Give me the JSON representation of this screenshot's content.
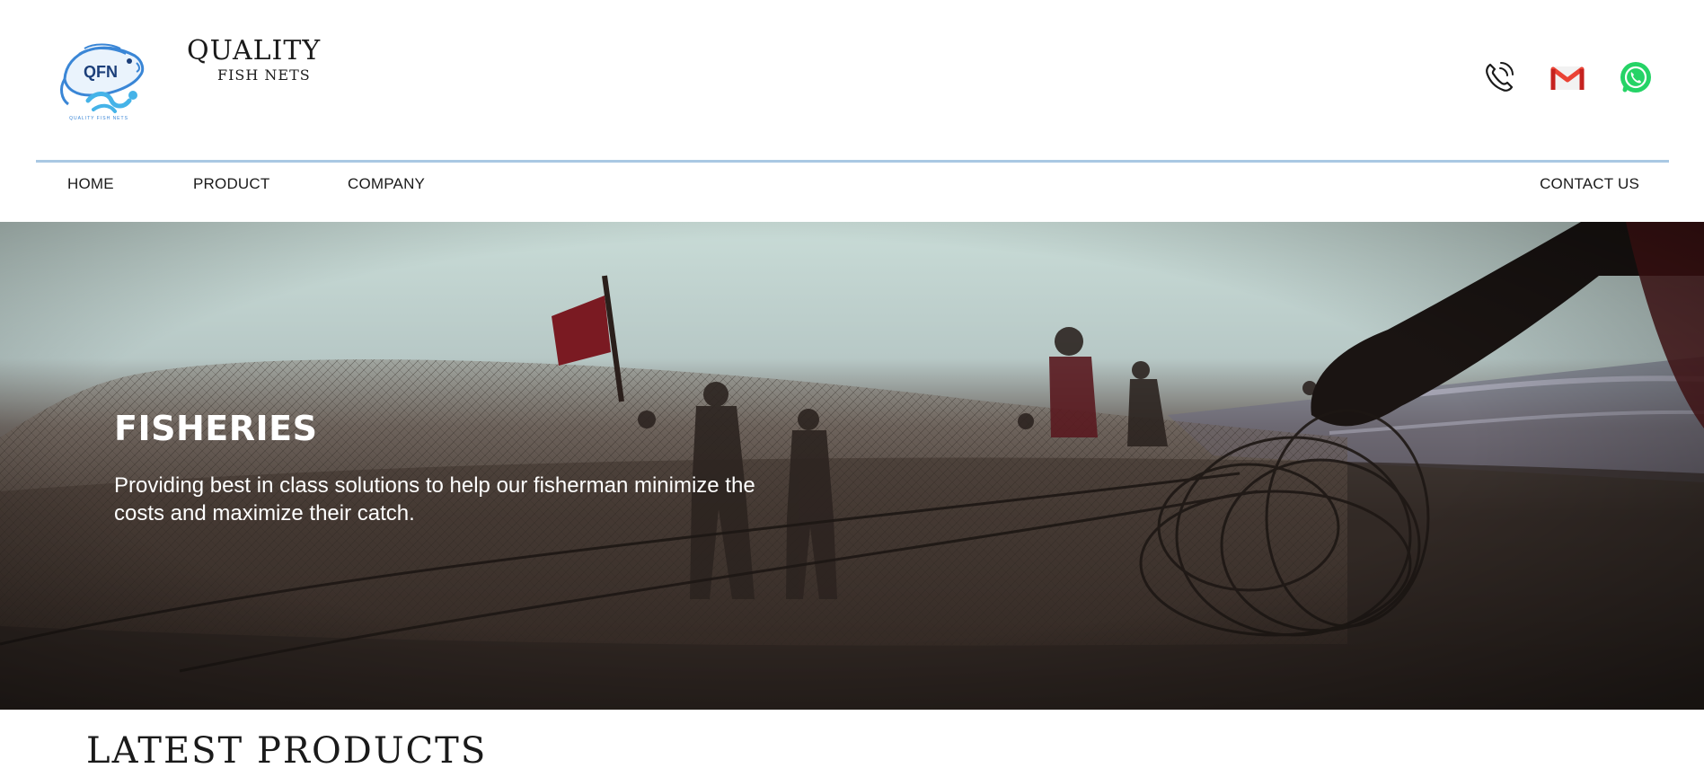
{
  "header": {
    "brand_title": "QUALITY",
    "brand_subtitle": "FISH NETS",
    "logo_text": "QFN",
    "logo_tagline": "QUALITY FISH NETS",
    "icons": [
      "phone-icon",
      "gmail-icon",
      "whatsapp-icon"
    ]
  },
  "nav": {
    "home": "HOME",
    "product": "PRODUCT",
    "company": "COMPANY",
    "contact": "CONTACT US"
  },
  "hero": {
    "title": "FISHERIES",
    "text": "Providing best in class solutions to help our fisherman minimize the costs and maximize their catch."
  },
  "latest": {
    "title": "LATEST PRODUCTS"
  },
  "colors": {
    "divider": "#a9c8e3",
    "logo_blue": "#3a86d6",
    "gmail_red": "#ea4335",
    "whatsapp_green": "#25d366"
  }
}
